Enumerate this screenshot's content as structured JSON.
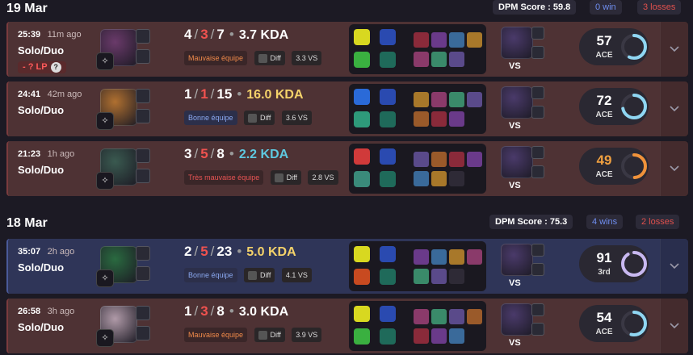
{
  "days": [
    {
      "date": "19 Mar",
      "dpm": "DPM Score : 59.8",
      "wins": "0 win",
      "losses": "3 losses",
      "matches": [
        {
          "result": "loss",
          "time": "25:39",
          "ago": "11m ago",
          "queue": "Solo/Duo",
          "lp": "- ? LP",
          "k": "4",
          "d": "3",
          "a": "7",
          "kda": "3.7 KDA",
          "team_tag": "Mauvaise équipe",
          "diff": "Diff",
          "vs_score": "3.3 VS",
          "vs": "VS",
          "score": "57",
          "score_label": "ACE",
          "score_fraction": 0.57,
          "ring_color": "#8fd6f2",
          "champ_color": "#6a3a6a"
        },
        {
          "result": "loss",
          "time": "24:41",
          "ago": "42m ago",
          "queue": "Solo/Duo",
          "k": "1",
          "d": "1",
          "a": "15",
          "kda": "16.0 KDA",
          "kda_color": "#f4d26a",
          "team_tag": "Bonne équipe",
          "diff": "Diff",
          "vs_score": "3.6 VS",
          "vs": "VS",
          "score": "72",
          "score_label": "ACE",
          "score_fraction": 0.72,
          "ring_color": "#8fd6f2",
          "champ_color": "#b07030"
        },
        {
          "result": "loss",
          "time": "21:23",
          "ago": "1h ago",
          "queue": "Solo/Duo",
          "k": "3",
          "d": "5",
          "a": "8",
          "kda": "2.2 KDA",
          "kda_color": "#5ec8e0",
          "team_tag": "Très mauvaise équipe",
          "diff": "Diff",
          "vs_score": "2.8 VS",
          "vs": "VS",
          "score": "49",
          "score_label": "ACE",
          "score_num_color": "#f0a040",
          "score_fraction": 0.49,
          "ring_color": "#f0923a",
          "champ_color": "#3a5a50"
        }
      ]
    },
    {
      "date": "18 Mar",
      "dpm": "DPM Score : 75.3",
      "wins": "4 wins",
      "losses": "2 losses",
      "matches": [
        {
          "result": "win",
          "time": "35:07",
          "ago": "2h ago",
          "queue": "Solo/Duo",
          "k": "2",
          "d": "5",
          "a": "23",
          "kda": "5.0 KDA",
          "kda_color": "#f4d26a",
          "team_tag": "Bonne équipe",
          "diff": "Diff",
          "vs_score": "4.1 VS",
          "vs": "VS",
          "score": "91",
          "score_label": "3rd",
          "score_fraction": 0.91,
          "ring_color": "#c8b8f0",
          "champ_color": "#2a6a40"
        },
        {
          "result": "loss",
          "time": "26:58",
          "ago": "3h ago",
          "queue": "Solo/Duo",
          "k": "1",
          "d": "3",
          "a": "8",
          "kda": "3.0 KDA",
          "team_tag": "Mauvaise équipe",
          "diff": "Diff",
          "vs_score": "3.9 VS",
          "vs": "VS",
          "score": "54",
          "score_label": "ACE",
          "score_fraction": 0.54,
          "ring_color": "#8fd6f2",
          "champ_color": "#b09aa8"
        }
      ]
    }
  ]
}
